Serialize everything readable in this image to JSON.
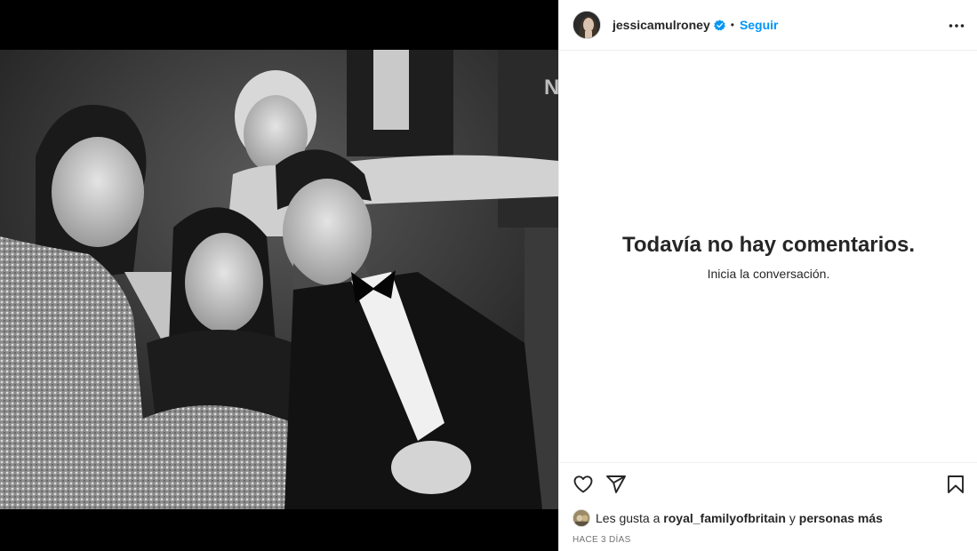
{
  "post": {
    "username": "jessicamulroney",
    "follow_label": "Seguir",
    "separator": "•",
    "verified": true,
    "icons": {
      "verified": "verified-badge-icon",
      "more": "more-options-icon",
      "like": "heart-icon",
      "share": "paper-plane-icon",
      "save": "bookmark-icon"
    }
  },
  "comments": {
    "empty_title": "Todavía no hay comentarios.",
    "empty_subtitle": "Inicia la conversación."
  },
  "likes": {
    "prefix": "Les gusta a",
    "user": "royal_familyofbritain",
    "connector": "y",
    "others": "personas más"
  },
  "timestamp": "HACE 3 DÍAS",
  "colors": {
    "accent": "#0095f6",
    "verified": "#0095f6",
    "text": "#262626",
    "muted": "#737373",
    "border": "#efefef"
  }
}
